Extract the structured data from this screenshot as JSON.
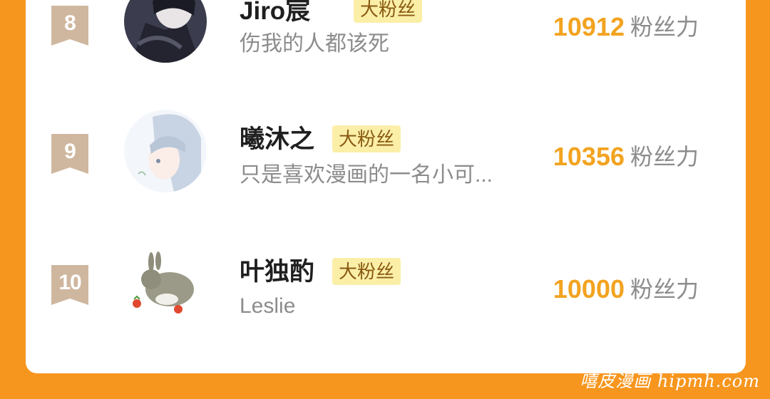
{
  "entries": [
    {
      "rank": "8",
      "name": "Jiro宸",
      "badge": "大粉丝",
      "bio": "伤我的人都该死",
      "score": "10912",
      "unit": "粉丝力",
      "avatar": "dark-anime-avatar"
    },
    {
      "rank": "9",
      "name": "曦沐之",
      "badge": "大粉丝",
      "bio": "只是喜欢漫画的一名小可...",
      "score": "10356",
      "unit": "粉丝力",
      "avatar": "anime-girl-avatar"
    },
    {
      "rank": "10",
      "name": "叶独酌",
      "badge": "大粉丝",
      "bio": "Leslie",
      "score": "10000",
      "unit": "粉丝力",
      "avatar": "rabbit-avatar"
    }
  ],
  "watermark": "嘻皮漫画 hipmh.com",
  "colors": {
    "background": "#F7961E",
    "score": "#F2A320",
    "badge_bg": "#FBEFA8",
    "rank_ribbon": "#CFB79F"
  }
}
